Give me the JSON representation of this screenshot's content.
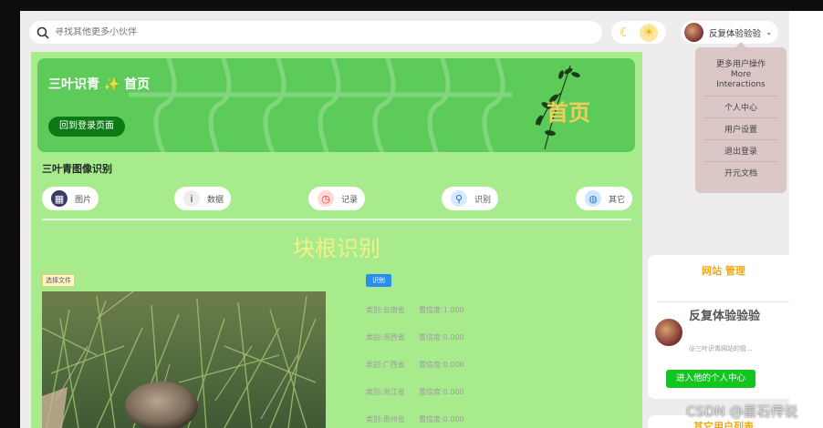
{
  "search": {
    "placeholder": "寻找其他更多小伙伴"
  },
  "theme": {
    "moon_icon": "moon-icon",
    "sun_icon": "sun-icon"
  },
  "user": {
    "name": "反复体验验验"
  },
  "dropdown": {
    "header_cn": "更多用户操作",
    "header_en_1": "More",
    "header_en_2": "Interactions",
    "items": [
      "个人中心",
      "用户设置",
      "退出登录",
      "开元文档"
    ]
  },
  "banner": {
    "title": "三叶识青 ✨ 首页",
    "back_button": "回到登录页面",
    "big_word": "首页"
  },
  "section": {
    "title": "三叶青图像识别"
  },
  "categories": [
    {
      "label": "图片",
      "icon": "image-icon"
    },
    {
      "label": "数据",
      "icon": "data-icon"
    },
    {
      "label": "记录",
      "icon": "clock-icon"
    },
    {
      "label": "识别",
      "icon": "search-icon"
    },
    {
      "label": "其它",
      "icon": "globe-icon"
    }
  ],
  "recognition": {
    "title": "块根识别",
    "file_tag": "选择文件",
    "result_tag": "识别",
    "rows": [
      {
        "type": "类别:云南省",
        "confidence": "置信度:1.000"
      },
      {
        "type": "类别:浙西省",
        "confidence": "置信度:0.000"
      },
      {
        "type": "类别:广西省",
        "confidence": "置信度:0.000"
      },
      {
        "type": "类别:浙江省",
        "confidence": "置信度:0.000"
      },
      {
        "type": "类别:贵州省",
        "confidence": "置信度:0.000"
      }
    ]
  },
  "site_card": {
    "title": "网站 管理",
    "name": "反复体验验验",
    "desc": "@三叶识青网站的管...",
    "button": "进入他的个人中心"
  },
  "site_card2": {
    "title": "其它用户列表"
  },
  "watermark": "CSDN @星石传说"
}
